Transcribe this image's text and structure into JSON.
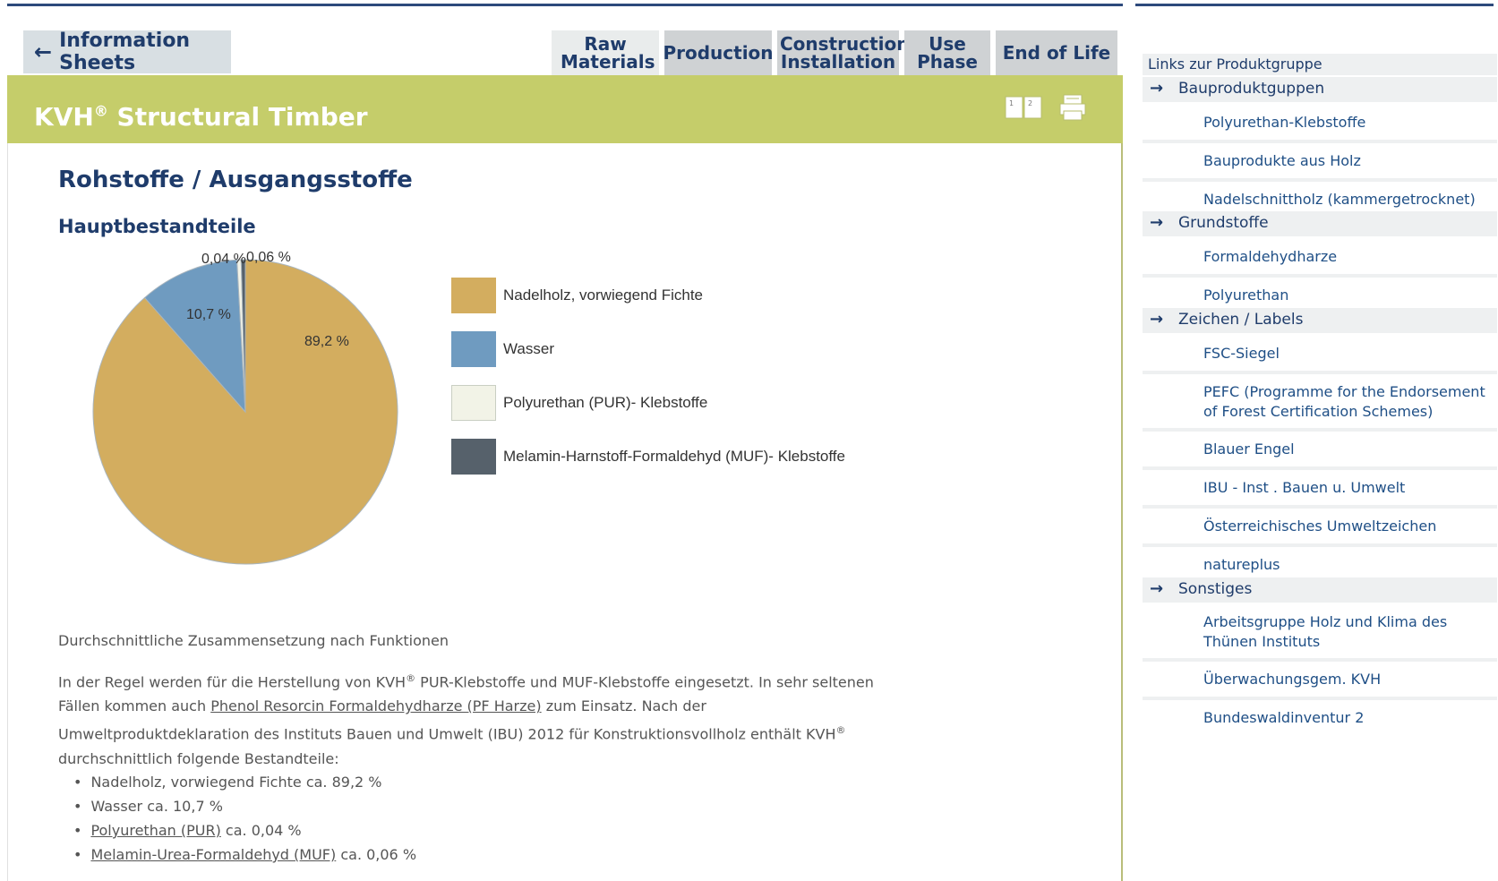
{
  "nav": {
    "back_label": "Information Sheets",
    "tabs": [
      {
        "label": "Raw Materials",
        "active": true
      },
      {
        "label": "Production",
        "active": false
      },
      {
        "label": "Construction Installation",
        "active": false
      },
      {
        "label": "Use Phase",
        "active": false
      },
      {
        "label": "End of Life",
        "active": false
      }
    ]
  },
  "header": {
    "title_main": "KVH",
    "title_reg": "®",
    "title_rest": " Structural Timber",
    "color": "#c5cd6a"
  },
  "content": {
    "heading": "Rohstoffe / Ausgangsstoffe",
    "subheading": "Hauptbestandteile",
    "caption": "Durchschnittliche Zusammensetzung nach Funktionen",
    "para": {
      "p1": "In der Regel werden für die Herstellung von KVH",
      "reg": "®",
      "p2": " PUR-Klebstoffe und MUF-Klebstoffe eingesetzt. In sehr seltenen Fällen kommen auch ",
      "link": "Phenol Resorcin Formaldehydharze (PF Harze)",
      "p3": " zum Einsatz. Nach der Umweltproduktdeklaration des Instituts Bauen und Umwelt (IBU) 2012 für Konstruktionsvollholz enthält KVH",
      "p4": " durchschnittlich folgende Bestandteile:"
    },
    "bullets": [
      {
        "text": "Nadelholz, vorwiegend Fichte ca. 89,2 %",
        "link": "",
        "rest": ""
      },
      {
        "text": "Wasser ca. 10,7 %",
        "link": "",
        "rest": ""
      },
      {
        "text": "",
        "link": "Polyurethan (PUR)",
        "rest": " ca. 0,04 %"
      },
      {
        "text": "",
        "link": "Melamin-Urea-Formaldehyd (MUF)",
        "rest": " ca. 0,06 %"
      }
    ]
  },
  "chart_data": {
    "type": "pie",
    "categories": [
      "Nadelholz, vorwiegend Fichte",
      "Wasser",
      "Polyurethan (PUR)- Klebstoffe",
      "Melamin-Harnstoff-Formaldehyd (MUF)- Klebstoffe"
    ],
    "values": [
      89.2,
      10.7,
      0.04,
      0.06
    ],
    "labels": [
      "89,2 %",
      "10,7 %",
      "0,04 %",
      "0,06 %"
    ],
    "colors": [
      "#d3ad5f",
      "#6f9bc0",
      "#f2f3e7",
      "#56616b"
    ],
    "legend_position": "right"
  },
  "sidebar": {
    "title": "Links zur Produktgruppe",
    "groups": [
      {
        "label": "Bauproduktguppen",
        "items": [
          "Polyurethan-Klebstoffe",
          "Bauprodukte aus Holz",
          "Nadelschnittholz (kammergetrocknet)"
        ]
      },
      {
        "label": "Grundstoffe",
        "items": [
          "Formaldehydharze",
          "Polyurethan"
        ]
      },
      {
        "label": "Zeichen / Labels",
        "items": [
          "FSC-Siegel",
          "PEFC (Programme for the Endorsement of Forest Certification Schemes)",
          "Blauer Engel",
          "IBU - Inst . Bauen u. Umwelt",
          "Österreichisches Umweltzeichen",
          "natureplus"
        ]
      },
      {
        "label": "Sonstiges",
        "items": [
          "Arbeitsgruppe Holz und Klima des Thünen Instituts",
          "Überwachungsgem. KVH",
          "Bundeswaldinventur 2"
        ]
      }
    ]
  }
}
